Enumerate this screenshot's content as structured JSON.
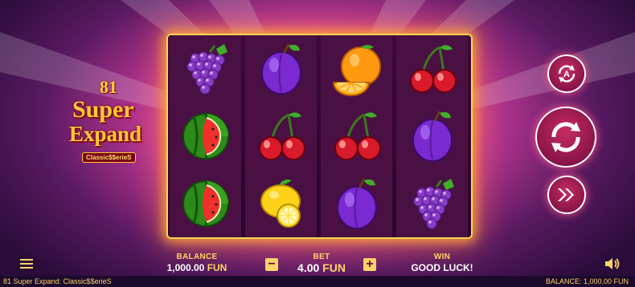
{
  "logo": {
    "number": "81",
    "line1": "Super",
    "line2": "Expand",
    "series": "Classic$$erieS"
  },
  "reels": [
    [
      "grapes",
      "watermelon",
      "watermelon"
    ],
    [
      "plum",
      "cherries",
      "lemon"
    ],
    [
      "orange",
      "cherries",
      "plum"
    ],
    [
      "cherries",
      "plum",
      "grapes"
    ]
  ],
  "controls": {
    "autoplay_icon": "autoplay-a-icon",
    "spin_icon": "spin-arrows-icon",
    "turbo_icon": "fast-forward-icon",
    "menu_icon": "hamburger-menu-icon",
    "sound_icon": "speaker-icon"
  },
  "hud": {
    "balance_label": "BALANCE",
    "balance_value": "1,000.00",
    "balance_currency": "FUN",
    "bet_label": "BET",
    "bet_value": "4.00",
    "bet_currency": "FUN",
    "minus_label": "−",
    "plus_label": "+",
    "win_label": "WIN",
    "win_value": "GOOD LUCK!"
  },
  "footer": {
    "game_name": "81 Super Expand: Classic$$erieS",
    "balance_text": "BALANCE: 1,000.00 FUN"
  },
  "colors": {
    "frame": "#ffd44d",
    "hud_label": "#ffd466",
    "button": "#c62c62"
  }
}
